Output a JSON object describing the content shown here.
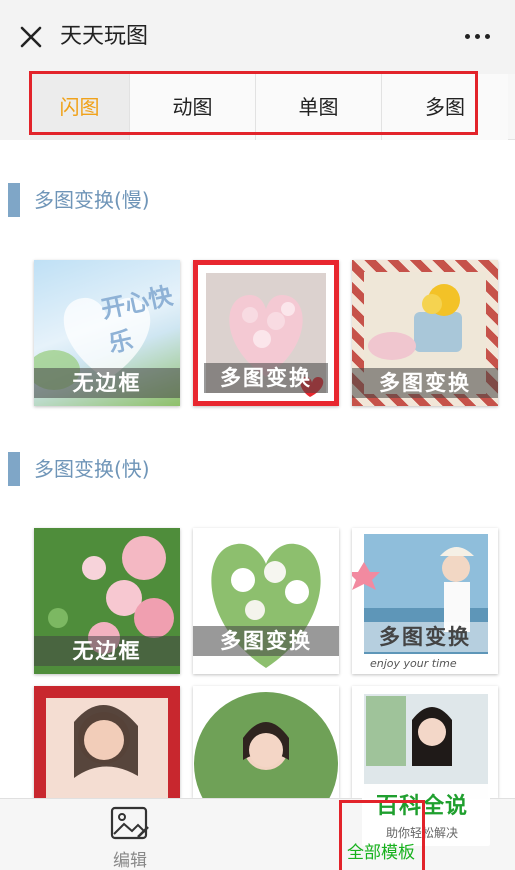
{
  "header": {
    "title": "天天玩图"
  },
  "tabs": [
    {
      "label": "闪图",
      "active": true
    },
    {
      "label": "动图",
      "active": false
    },
    {
      "label": "单图",
      "active": false
    },
    {
      "label": "多图",
      "active": false
    }
  ],
  "sections": [
    {
      "title": "多图变换(慢)"
    },
    {
      "title": "多图变换(快)"
    }
  ],
  "cards": [
    {
      "caption": "无边框",
      "overlay": "开心快乐"
    },
    {
      "caption": "多图变换"
    },
    {
      "caption": "多图变换"
    },
    {
      "caption": "无边框"
    },
    {
      "caption": "多图变换"
    },
    {
      "caption": "多图变换",
      "subtext": "enjoy your time"
    },
    {
      "caption": ""
    },
    {
      "caption": ""
    },
    {
      "caption": ""
    }
  ],
  "bottom_bar": {
    "edit_label": "编辑",
    "templates_label": "全部模板"
  },
  "watermark": {
    "main": "百科全说",
    "sub": "助你轻松解决"
  },
  "colors": {
    "active_tab": "#f0a21a",
    "section_accent": "#7fa6c7",
    "templates_green": "#18b21e",
    "highlight_red": "#e2232a"
  }
}
